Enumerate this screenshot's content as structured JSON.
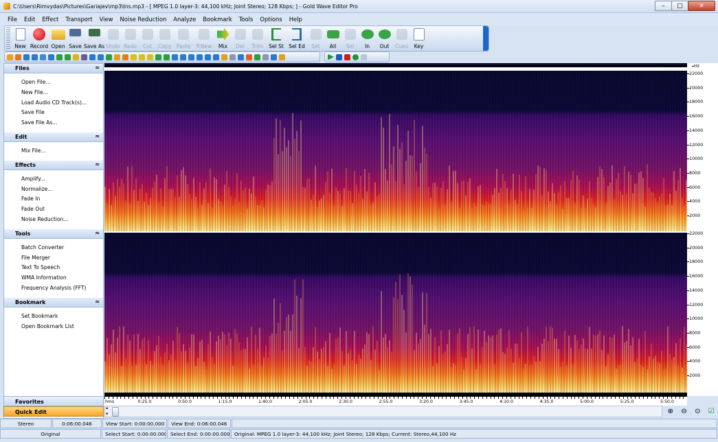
{
  "window": {
    "title": "C:\\Users\\Rimvydas\\Pictures\\Gariajev\\mp3\\Ins.mp3 - [ MPEG 1.0 layer-3: 44,100 kHz; Joint Stereo; 128 Kbps; ] - Gold Wave Editor Pro",
    "minimize": "–",
    "maximize": "□",
    "close": "✕"
  },
  "menu": [
    "File",
    "Edit",
    "Effect",
    "Transport",
    "View",
    "Noise Reduction",
    "Analyze",
    "Bookmark",
    "Tools",
    "Options",
    "Help"
  ],
  "toolbar": [
    {
      "label": "New",
      "icon": "new-page-icon",
      "enabled": true
    },
    {
      "label": "Record",
      "icon": "record-icon",
      "enabled": true
    },
    {
      "label": "Open",
      "icon": "folder-icon",
      "enabled": true
    },
    {
      "label": "Save",
      "icon": "floppy-icon",
      "enabled": true
    },
    {
      "label": "Save As",
      "icon": "save-as-icon",
      "enabled": true
    },
    {
      "label": "Undo",
      "icon": "undo-icon",
      "enabled": false
    },
    {
      "label": "Redo",
      "icon": "redo-icon",
      "enabled": false
    },
    {
      "label": "Cut",
      "icon": "scissors-icon",
      "enabled": false
    },
    {
      "label": "Copy",
      "icon": "copy-icon",
      "enabled": false
    },
    {
      "label": "Paste",
      "icon": "paste-icon",
      "enabled": false
    },
    {
      "label": "P.New",
      "icon": "paste-new-icon",
      "enabled": false
    },
    {
      "label": "Mix",
      "icon": "mix-icon",
      "enabled": true
    },
    {
      "label": "Del",
      "icon": "delete-icon",
      "enabled": false
    },
    {
      "label": "Trim",
      "icon": "trim-icon",
      "enabled": false
    },
    {
      "label": "Sel St",
      "icon": "select-start-icon",
      "enabled": true
    },
    {
      "label": "Sel Ed",
      "icon": "select-end-icon",
      "enabled": true
    },
    {
      "label": "Set",
      "icon": "set-icon",
      "enabled": false
    },
    {
      "label": "All",
      "icon": "zoom-all-icon",
      "enabled": true
    },
    {
      "label": "Sel",
      "icon": "zoom-selection-icon",
      "enabled": false
    },
    {
      "label": "In",
      "icon": "zoom-in-icon",
      "enabled": true
    },
    {
      "label": "Out",
      "icon": "zoom-out-icon",
      "enabled": true
    },
    {
      "label": "Cues",
      "icon": "cues-icon",
      "enabled": false
    },
    {
      "label": "Key",
      "icon": "key-icon",
      "enabled": true
    }
  ],
  "sidebar": {
    "sections": [
      {
        "title": "Files",
        "items": [
          "Open File...",
          "New File...",
          "Load Audio CD Track(s)...",
          "Save File",
          "Save File As..."
        ]
      },
      {
        "title": "Edit",
        "items": [
          "Mix File..."
        ]
      },
      {
        "title": "Effects",
        "items": [
          "Amplify...",
          "Normalize...",
          "Fade In",
          "Fade Out",
          "Noise Reduction..."
        ]
      },
      {
        "title": "Tools",
        "items": [
          "Batch Converter",
          "File Merger",
          "Text To Speech",
          "WMA Information",
          "Frequency Analysis (FFT)"
        ]
      },
      {
        "title": "Bookmark",
        "items": [
          "Set Bookmark",
          "Open Bookmark List"
        ]
      }
    ],
    "favorites": "Favorites",
    "quick_edit": "Quick Edit"
  },
  "freq_axis": {
    "unit": "Hz",
    "top_ticks": [
      "22000",
      "20000",
      "18000",
      "16000",
      "14000",
      "12000",
      "10000",
      "8000",
      "6000",
      "4000",
      "2000"
    ],
    "bottom_ticks": [
      "22000",
      "20000",
      "18000",
      "16000",
      "14000",
      "12000",
      "10000",
      "8000",
      "6000",
      "4000",
      "2000"
    ]
  },
  "timeline": {
    "unit": "hms",
    "labels": [
      "0:25.0",
      "0:50.0",
      "1:15.0",
      "1:40.0",
      "2:05.0",
      "2:30.0",
      "2:55.0",
      "3:20.0",
      "3:45.0",
      "4:10.0",
      "4:35.0",
      "5:00.0",
      "5:25.0",
      "5:50.0"
    ]
  },
  "status": {
    "row1": {
      "channels": "Stereo",
      "duration": "0:06:00.046",
      "view_start": "View Start: 0:00:00.000",
      "view_end": "View End: 0:06:00.046"
    },
    "row2": {
      "mode": "Original",
      "select_start": "Select Start: 0:00:00.000",
      "select_end": "Select End: 0:00:00.000",
      "info": "Original: MPEG 1.0 layer-3: 44,100 kHz; Joint Stereo; 128 Kbps;  Current: Stereo,44,100 Hz"
    }
  },
  "colors": {
    "accent": "#1e66c8",
    "spectrogram_bg": "#0a0930"
  }
}
